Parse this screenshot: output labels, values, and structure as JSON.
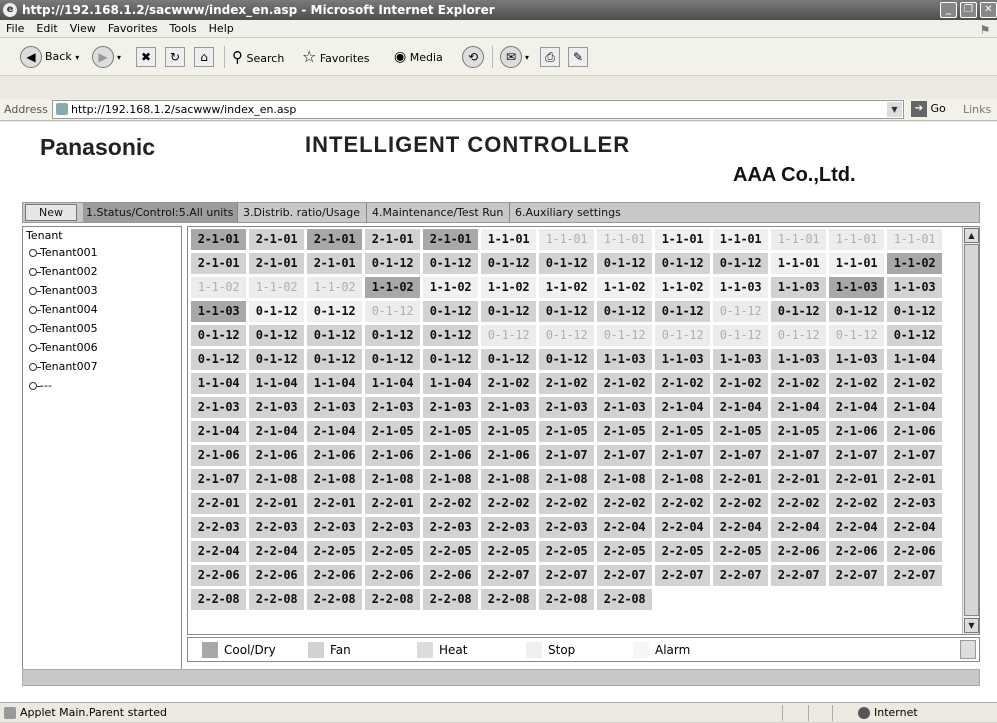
{
  "window": {
    "title": "http://192.168.1.2/sacwww/index_en.asp - Microsoft Internet Explorer",
    "controls": {
      "minimize": "_",
      "restore": "❐",
      "close": "✕"
    }
  },
  "menu": [
    "File",
    "Edit",
    "View",
    "Favorites",
    "Tools",
    "Help"
  ],
  "toolbar": {
    "back": "Back",
    "search": "Search",
    "favorites": "Favorites",
    "media": "Media"
  },
  "address": {
    "label": "Address",
    "url": "http://192.168.1.2/sacwww/index_en.asp",
    "go": "Go",
    "links": "Links"
  },
  "page": {
    "brand": "Panasonic",
    "title": "INTELLIGENT CONTROLLER",
    "company": "AAA Co.,Ltd."
  },
  "nav_tabs": [
    {
      "label": "New",
      "state": "button"
    },
    {
      "label": "1.Status/Control:5.All units",
      "state": "active"
    },
    {
      "label": "3.Distrib. ratio/Usage",
      "state": "normal"
    },
    {
      "label": "4.Maintenance/Test Run",
      "state": "normal"
    },
    {
      "label": "6.Auxiliary settings",
      "state": "normal"
    }
  ],
  "tenants": {
    "header": "Tenant",
    "items": [
      "Tenant001",
      "Tenant002",
      "Tenant003",
      "Tenant004",
      "Tenant005",
      "Tenant006",
      "Tenant007",
      "---"
    ]
  },
  "legend": [
    {
      "label": "Cool/Dry",
      "mode": "cool",
      "color": "#a8a8a8"
    },
    {
      "label": "Fan",
      "mode": "fan",
      "color": "#d2d2d2"
    },
    {
      "label": "Heat",
      "mode": "heat",
      "color": "#dcdcdc"
    },
    {
      "label": "Stop",
      "mode": "stop",
      "color": "#f0f0f0"
    },
    {
      "label": "Alarm",
      "mode": "alarm",
      "color": "#f6f6f6"
    }
  ],
  "units": [
    [
      "2-1-01",
      "cool"
    ],
    [
      "2-1-01",
      "fan"
    ],
    [
      "2-1-01",
      "cool"
    ],
    [
      "2-1-01",
      "fan"
    ],
    [
      "2-1-01",
      "cool"
    ],
    [
      "1-1-01",
      "stop"
    ],
    [
      "1-1-01",
      "alarm"
    ],
    [
      "1-1-01",
      "alarm"
    ],
    [
      "1-1-01",
      "stop"
    ],
    [
      "1-1-01",
      "stop"
    ],
    [
      "1-1-01",
      "alarm"
    ],
    [
      "1-1-01",
      "alarm"
    ],
    [
      "1-1-01",
      "alarm"
    ],
    [
      "2-1-01",
      "fan"
    ],
    [
      "2-1-01",
      "fan"
    ],
    [
      "2-1-01",
      "fan"
    ],
    [
      "0-1-12",
      "fan"
    ],
    [
      "0-1-12",
      "fan"
    ],
    [
      "0-1-12",
      "fan"
    ],
    [
      "0-1-12",
      "fan"
    ],
    [
      "0-1-12",
      "fan"
    ],
    [
      "0-1-12",
      "fan"
    ],
    [
      "0-1-12",
      "fan"
    ],
    [
      "1-1-01",
      "stop"
    ],
    [
      "1-1-01",
      "stop"
    ],
    [
      "1-1-02",
      "cool"
    ],
    [
      "1-1-02",
      "alarm"
    ],
    [
      "1-1-02",
      "alarm"
    ],
    [
      "1-1-02",
      "alarm"
    ],
    [
      "1-1-02",
      "cool"
    ],
    [
      "1-1-02",
      "stop"
    ],
    [
      "1-1-02",
      "stop"
    ],
    [
      "1-1-02",
      "stop"
    ],
    [
      "1-1-02",
      "stop"
    ],
    [
      "1-1-02",
      "stop"
    ],
    [
      "1-1-03",
      "stop"
    ],
    [
      "1-1-03",
      "fan"
    ],
    [
      "1-1-03",
      "cool"
    ],
    [
      "1-1-03",
      "fan"
    ],
    [
      "1-1-03",
      "cool"
    ],
    [
      "0-1-12",
      "stop"
    ],
    [
      "0-1-12",
      "stop"
    ],
    [
      "0-1-12",
      "alarm"
    ],
    [
      "0-1-12",
      "fan"
    ],
    [
      "0-1-12",
      "fan"
    ],
    [
      "0-1-12",
      "fan"
    ],
    [
      "0-1-12",
      "fan"
    ],
    [
      "0-1-12",
      "fan"
    ],
    [
      "0-1-12",
      "alarm"
    ],
    [
      "0-1-12",
      "fan"
    ],
    [
      "0-1-12",
      "fan"
    ],
    [
      "0-1-12",
      "fan"
    ],
    [
      "0-1-12",
      "fan"
    ],
    [
      "0-1-12",
      "fan"
    ],
    [
      "0-1-12",
      "fan"
    ],
    [
      "0-1-12",
      "fan"
    ],
    [
      "0-1-12",
      "fan"
    ],
    [
      "0-1-12",
      "alarm"
    ],
    [
      "0-1-12",
      "alarm"
    ],
    [
      "0-1-12",
      "alarm"
    ],
    [
      "0-1-12",
      "alarm"
    ],
    [
      "0-1-12",
      "alarm"
    ],
    [
      "0-1-12",
      "alarm"
    ],
    [
      "0-1-12",
      "alarm"
    ],
    [
      "0-1-12",
      "fan"
    ],
    [
      "0-1-12",
      "fan"
    ],
    [
      "0-1-12",
      "fan"
    ],
    [
      "0-1-12",
      "fan"
    ],
    [
      "0-1-12",
      "fan"
    ],
    [
      "0-1-12",
      "fan"
    ],
    [
      "0-1-12",
      "fan"
    ],
    [
      "0-1-12",
      "fan"
    ],
    [
      "1-1-03",
      "fan"
    ],
    [
      "1-1-03",
      "fan"
    ],
    [
      "1-1-03",
      "fan"
    ],
    [
      "1-1-03",
      "fan"
    ],
    [
      "1-1-03",
      "fan"
    ],
    [
      "1-1-04",
      "fan"
    ],
    [
      "1-1-04",
      "fan"
    ],
    [
      "1-1-04",
      "fan"
    ],
    [
      "1-1-04",
      "fan"
    ],
    [
      "1-1-04",
      "fan"
    ],
    [
      "1-1-04",
      "fan"
    ],
    [
      "2-1-02",
      "fan"
    ],
    [
      "2-1-02",
      "fan"
    ],
    [
      "2-1-02",
      "fan"
    ],
    [
      "2-1-02",
      "fan"
    ],
    [
      "2-1-02",
      "fan"
    ],
    [
      "2-1-02",
      "fan"
    ],
    [
      "2-1-02",
      "fan"
    ],
    [
      "2-1-02",
      "fan"
    ],
    [
      "2-1-03",
      "fan"
    ],
    [
      "2-1-03",
      "fan"
    ],
    [
      "2-1-03",
      "fan"
    ],
    [
      "2-1-03",
      "fan"
    ],
    [
      "2-1-03",
      "fan"
    ],
    [
      "2-1-03",
      "fan"
    ],
    [
      "2-1-03",
      "fan"
    ],
    [
      "2-1-03",
      "fan"
    ],
    [
      "2-1-04",
      "fan"
    ],
    [
      "2-1-04",
      "fan"
    ],
    [
      "2-1-04",
      "fan"
    ],
    [
      "2-1-04",
      "fan"
    ],
    [
      "2-1-04",
      "fan"
    ],
    [
      "2-1-04",
      "fan"
    ],
    [
      "2-1-04",
      "fan"
    ],
    [
      "2-1-04",
      "fan"
    ],
    [
      "2-1-05",
      "fan"
    ],
    [
      "2-1-05",
      "fan"
    ],
    [
      "2-1-05",
      "fan"
    ],
    [
      "2-1-05",
      "fan"
    ],
    [
      "2-1-05",
      "fan"
    ],
    [
      "2-1-05",
      "fan"
    ],
    [
      "2-1-05",
      "fan"
    ],
    [
      "2-1-05",
      "fan"
    ],
    [
      "2-1-06",
      "fan"
    ],
    [
      "2-1-06",
      "fan"
    ],
    [
      "2-1-06",
      "fan"
    ],
    [
      "2-1-06",
      "fan"
    ],
    [
      "2-1-06",
      "fan"
    ],
    [
      "2-1-06",
      "fan"
    ],
    [
      "2-1-06",
      "fan"
    ],
    [
      "2-1-06",
      "fan"
    ],
    [
      "2-1-07",
      "fan"
    ],
    [
      "2-1-07",
      "fan"
    ],
    [
      "2-1-07",
      "fan"
    ],
    [
      "2-1-07",
      "fan"
    ],
    [
      "2-1-07",
      "fan"
    ],
    [
      "2-1-07",
      "fan"
    ],
    [
      "2-1-07",
      "fan"
    ],
    [
      "2-1-07",
      "fan"
    ],
    [
      "2-1-08",
      "fan"
    ],
    [
      "2-1-08",
      "fan"
    ],
    [
      "2-1-08",
      "fan"
    ],
    [
      "2-1-08",
      "fan"
    ],
    [
      "2-1-08",
      "fan"
    ],
    [
      "2-1-08",
      "fan"
    ],
    [
      "2-1-08",
      "fan"
    ],
    [
      "2-1-08",
      "fan"
    ],
    [
      "2-2-01",
      "fan"
    ],
    [
      "2-2-01",
      "fan"
    ],
    [
      "2-2-01",
      "fan"
    ],
    [
      "2-2-01",
      "fan"
    ],
    [
      "2-2-01",
      "fan"
    ],
    [
      "2-2-01",
      "fan"
    ],
    [
      "2-2-01",
      "fan"
    ],
    [
      "2-2-01",
      "fan"
    ],
    [
      "2-2-02",
      "fan"
    ],
    [
      "2-2-02",
      "fan"
    ],
    [
      "2-2-02",
      "fan"
    ],
    [
      "2-2-02",
      "fan"
    ],
    [
      "2-2-02",
      "fan"
    ],
    [
      "2-2-02",
      "fan"
    ],
    [
      "2-2-02",
      "fan"
    ],
    [
      "2-2-02",
      "fan"
    ],
    [
      "2-2-03",
      "fan"
    ],
    [
      "2-2-03",
      "fan"
    ],
    [
      "2-2-03",
      "fan"
    ],
    [
      "2-2-03",
      "fan"
    ],
    [
      "2-2-03",
      "fan"
    ],
    [
      "2-2-03",
      "fan"
    ],
    [
      "2-2-03",
      "fan"
    ],
    [
      "2-2-03",
      "fan"
    ],
    [
      "2-2-04",
      "fan"
    ],
    [
      "2-2-04",
      "fan"
    ],
    [
      "2-2-04",
      "fan"
    ],
    [
      "2-2-04",
      "fan"
    ],
    [
      "2-2-04",
      "fan"
    ],
    [
      "2-2-04",
      "fan"
    ],
    [
      "2-2-04",
      "fan"
    ],
    [
      "2-2-04",
      "fan"
    ],
    [
      "2-2-05",
      "fan"
    ],
    [
      "2-2-05",
      "fan"
    ],
    [
      "2-2-05",
      "fan"
    ],
    [
      "2-2-05",
      "fan"
    ],
    [
      "2-2-05",
      "fan"
    ],
    [
      "2-2-05",
      "fan"
    ],
    [
      "2-2-05",
      "fan"
    ],
    [
      "2-2-05",
      "fan"
    ],
    [
      "2-2-06",
      "fan"
    ],
    [
      "2-2-06",
      "fan"
    ],
    [
      "2-2-06",
      "fan"
    ],
    [
      "2-2-06",
      "fan"
    ],
    [
      "2-2-06",
      "fan"
    ],
    [
      "2-2-06",
      "fan"
    ],
    [
      "2-2-06",
      "fan"
    ],
    [
      "2-2-06",
      "fan"
    ],
    [
      "2-2-07",
      "fan"
    ],
    [
      "2-2-07",
      "fan"
    ],
    [
      "2-2-07",
      "fan"
    ],
    [
      "2-2-07",
      "fan"
    ],
    [
      "2-2-07",
      "fan"
    ],
    [
      "2-2-07",
      "fan"
    ],
    [
      "2-2-07",
      "fan"
    ],
    [
      "2-2-07",
      "fan"
    ],
    [
      "2-2-08",
      "fan"
    ],
    [
      "2-2-08",
      "fan"
    ],
    [
      "2-2-08",
      "fan"
    ],
    [
      "2-2-08",
      "fan"
    ],
    [
      "2-2-08",
      "fan"
    ],
    [
      "2-2-08",
      "fan"
    ],
    [
      "2-2-08",
      "fan"
    ],
    [
      "2-2-08",
      "fan"
    ]
  ],
  "status": {
    "text": "Applet Main.Parent started",
    "zone": "Internet"
  }
}
